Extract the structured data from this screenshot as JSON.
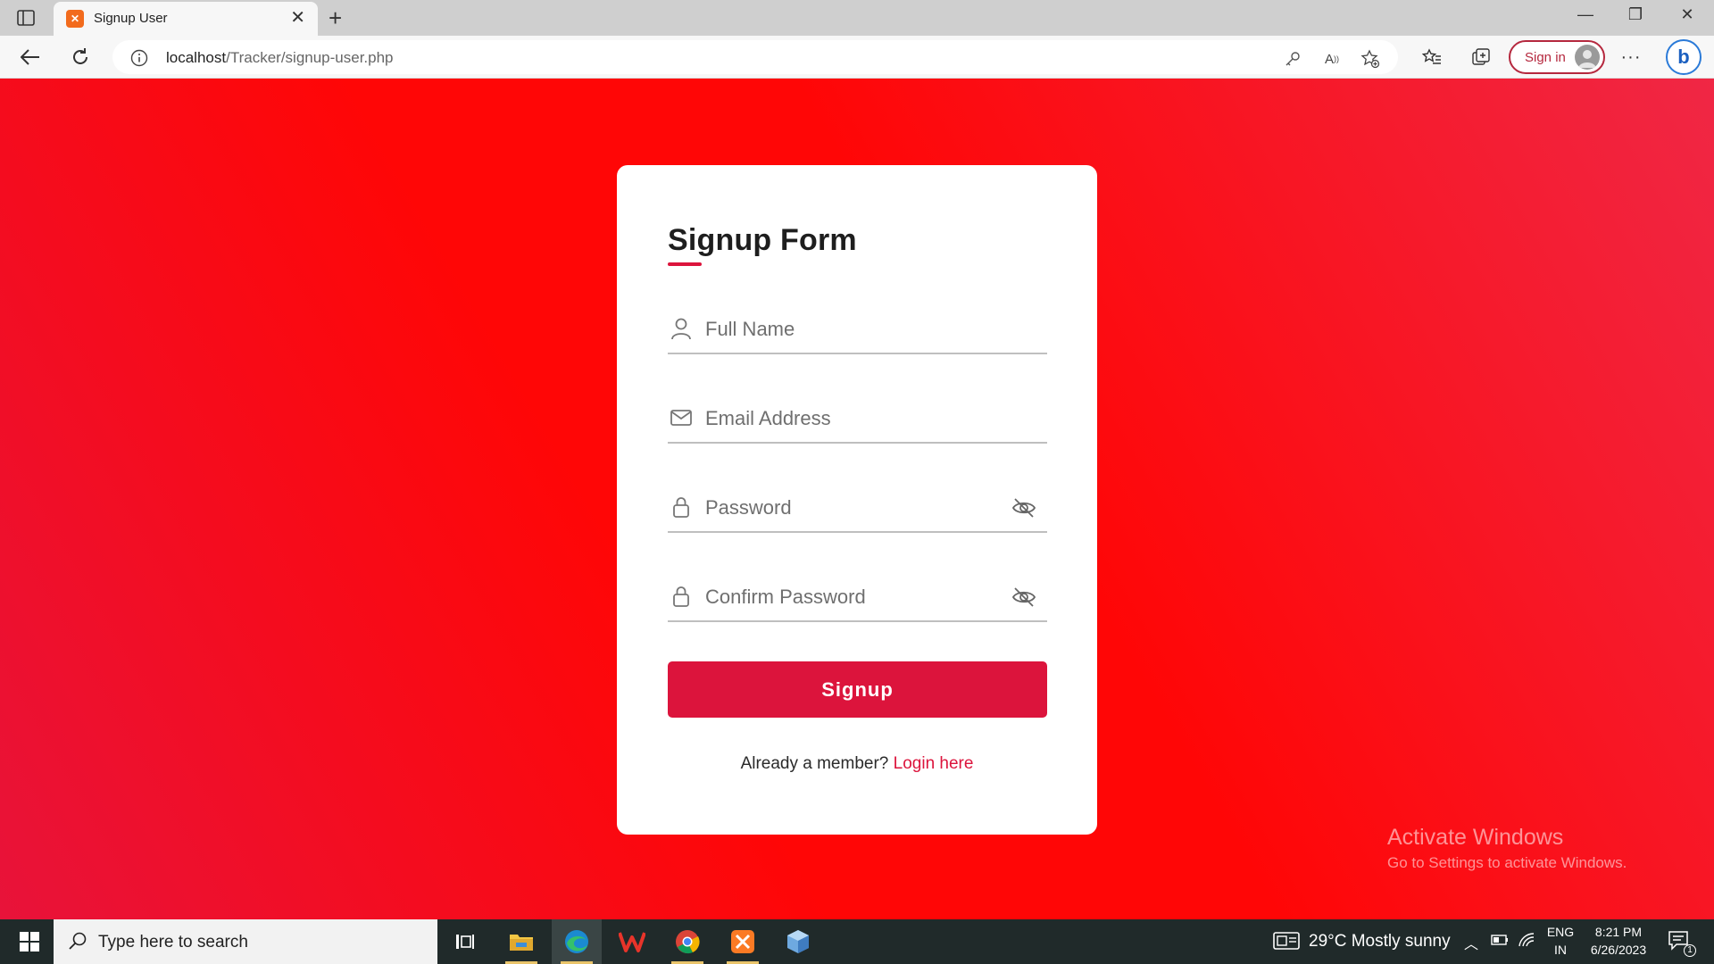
{
  "browser": {
    "tab_title": "Signup User",
    "favicon_text": "✕",
    "url_host": "localhost",
    "url_path": "/Tracker/signup-user.php",
    "signin_label": "Sign in"
  },
  "form": {
    "title": "Signup Form",
    "fields": [
      {
        "placeholder": "Full Name",
        "icon": "user-icon"
      },
      {
        "placeholder": "Email Address",
        "icon": "mail-icon"
      },
      {
        "placeholder": "Password",
        "icon": "lock-icon"
      },
      {
        "placeholder": "Confirm Password",
        "icon": "lock-icon"
      }
    ],
    "submit_label": "Signup",
    "member_text": "Already a member?",
    "login_link": "Login here",
    "accent_color": "#dc143c"
  },
  "watermark": {
    "line1": "Activate Windows",
    "line2": "Go to Settings to activate Windows."
  },
  "taskbar": {
    "search_placeholder": "Type here to search",
    "weather": "29°C  Mostly sunny",
    "lang_top": "ENG",
    "lang_bottom": "IN",
    "time": "8:21 PM",
    "date": "6/26/2023",
    "notification_count": "1"
  }
}
